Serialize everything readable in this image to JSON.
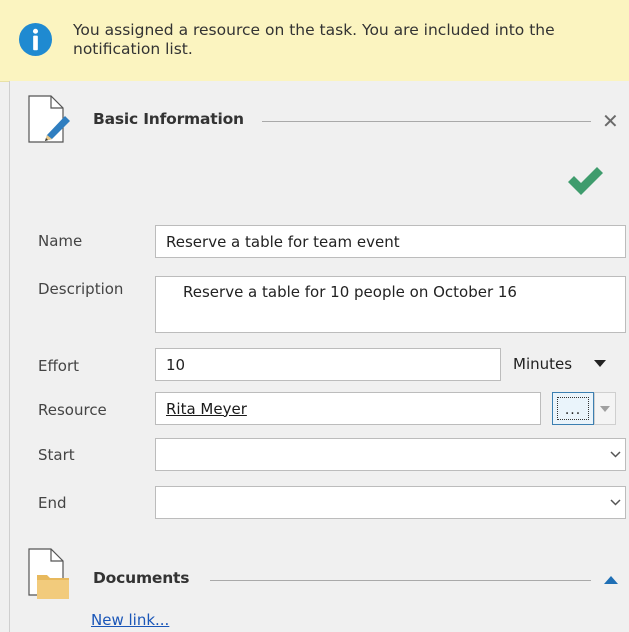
{
  "notification": {
    "icon": "info-icon",
    "message": "You assigned a resource on the task. You are included into the notification list."
  },
  "basic_info": {
    "title": "Basic Information",
    "icon": "edit-document-icon",
    "close_glyph": "✕"
  },
  "form": {
    "name_label": "Name",
    "name_value": "Reserve a table for team event",
    "description_label": "Description",
    "description_value": "Reserve a table for 10 people on October 16",
    "effort_label": "Effort",
    "effort_value": "10",
    "effort_unit": "Minutes",
    "resource_label": "Resource",
    "resource_value": "Rita Meyer",
    "resource_button": "...",
    "start_label": "Start",
    "start_value": "",
    "end_label": "End",
    "end_value": ""
  },
  "documents": {
    "title": "Documents",
    "icon": "folder-document-icon",
    "new_link": "New link..."
  },
  "colors": {
    "notification_bg": "#fbf4c0",
    "info_blue": "#1f8ad1",
    "check_green": "#3f9c6d",
    "link_blue": "#1a56b8",
    "panel_bg": "#f0f0f0"
  }
}
